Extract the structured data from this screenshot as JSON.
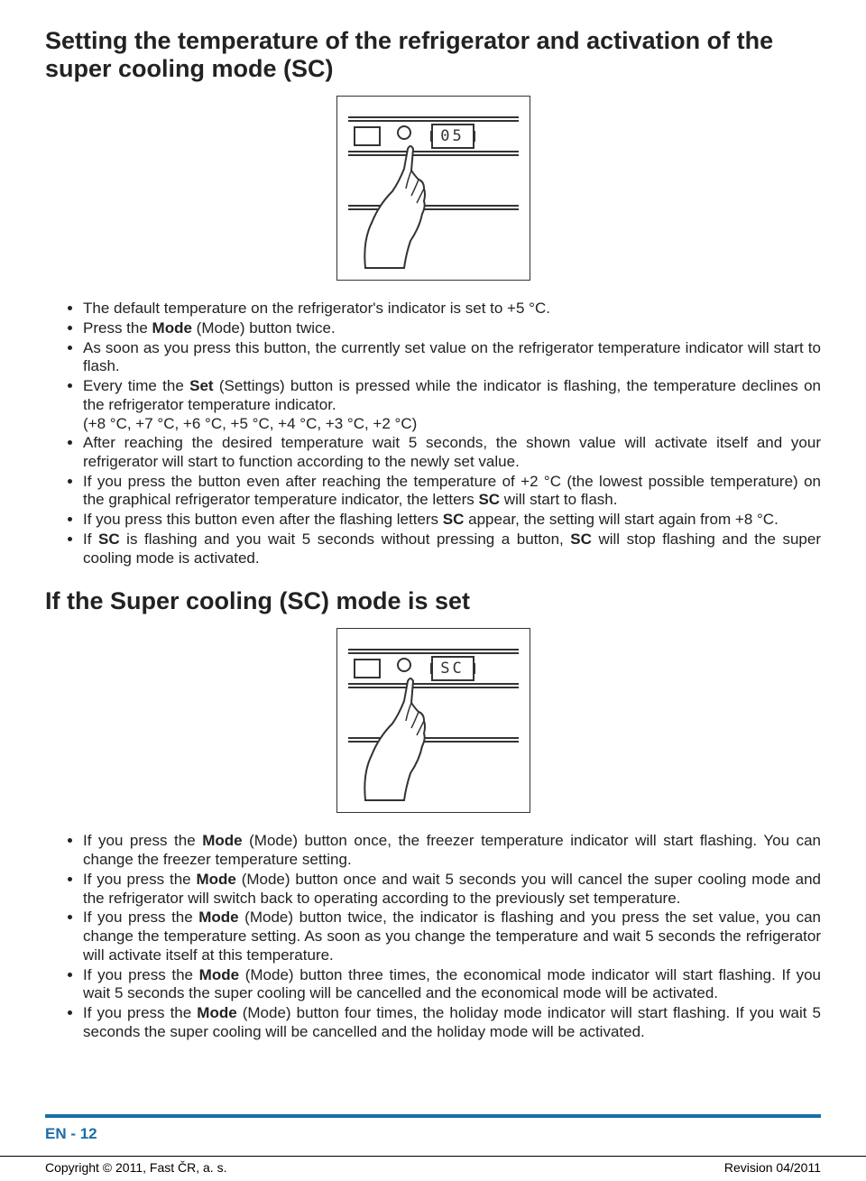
{
  "heading1": "Setting the temperature of the refrigerator and activation of the super cooling mode (SC)",
  "figure1": {
    "display": "05"
  },
  "list1": [
    {
      "pre": "The default temperature on the refrigerator's indicator is set to +5 °C."
    },
    {
      "pre": "Press the ",
      "b": "Mode",
      "post": " (Mode) button twice."
    },
    {
      "pre": "As soon as you press this button, the currently set value on the refrigerator temperature indicator will start to flash."
    },
    {
      "pre": "Every time the ",
      "b": "Set",
      "post": " (Settings) button is pressed while the indicator is flashing, the temperature declines on the refrigerator temperature indicator.",
      "br": "(+8 °C, +7 °C, +6 °C, +5 °C, +4 °C, +3 °C, +2 °C)"
    },
    {
      "pre": "After reaching the desired temperature wait 5 seconds, the shown value will activate itself and your refrigerator will start to function according to the newly set value."
    },
    {
      "pre": "If you press the button even after reaching the temperature of +2 °C (the lowest possible temperature) on the graphical refrigerator temperature indicator, the letters ",
      "b": "SC",
      "post": " will start to flash."
    },
    {
      "pre": "If you press this button even after the flashing letters ",
      "b": "SC",
      "post": " appear, the setting will start again from +8 °C."
    },
    {
      "pre": "If ",
      "b": "SC",
      "mid": " is flashing and you wait 5 seconds without pressing a button, ",
      "b2": "SC",
      "post": " will stop flashing and the super cooling mode is activated."
    }
  ],
  "heading2": "If the Super cooling (SC) mode is set",
  "figure2": {
    "display": "SC"
  },
  "list2": [
    {
      "pre": "If you press the ",
      "b": "Mode",
      "post": " (Mode) button once, the freezer temperature indicator will start flashing. You can change the freezer temperature setting."
    },
    {
      "pre": "If you press the ",
      "b": "Mode",
      "post": " (Mode) button once and wait 5 seconds you will cancel the super cooling mode and the refrigerator will switch back to operating according to the previously set temperature."
    },
    {
      "pre": "If you press the ",
      "b": "Mode",
      "post": " (Mode) button twice, the indicator is flashing and you press the set value, you can change the temperature setting. As soon as you change the temperature and wait 5 seconds the refrigerator will activate itself at this temperature."
    },
    {
      "pre": "If you press the ",
      "b": "Mode",
      "post": " (Mode) button three times, the economical mode indicator will start flashing. If you wait 5 seconds the super cooling will be cancelled and the economical mode will be activated."
    },
    {
      "pre": "If you press the ",
      "b": "Mode",
      "post": " (Mode) button four times, the holiday mode indicator will start flashing. If you wait 5 seconds the super cooling will be cancelled and the holiday mode will be activated."
    }
  ],
  "page_num": "EN - 12",
  "copyright": "Copyright © 2011, Fast ČR, a. s.",
  "revision": "Revision 04/2011"
}
